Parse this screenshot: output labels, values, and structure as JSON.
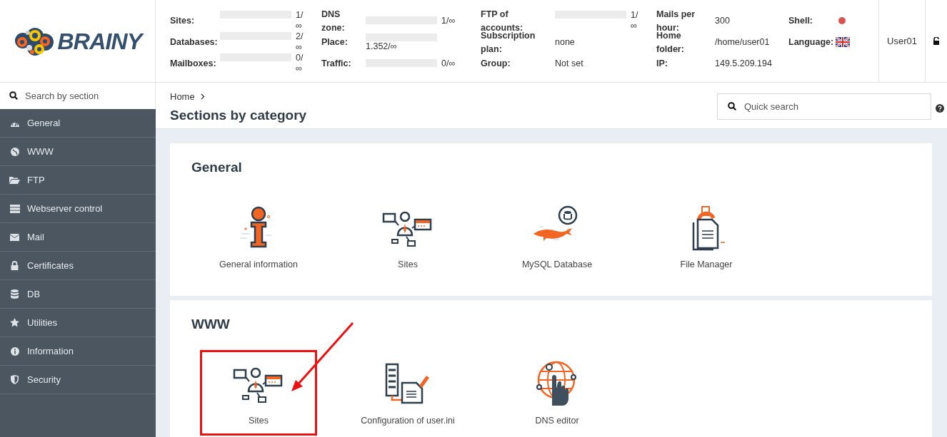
{
  "logo": {
    "text": "BRAINY"
  },
  "stats": [
    [
      {
        "label": "Sites:",
        "kind": "meter",
        "level": 0,
        "value": "1/∞"
      },
      {
        "label": "Databases:",
        "kind": "meter",
        "level": 0,
        "value": "2/∞"
      },
      {
        "label": "Mailboxes:",
        "kind": "meter",
        "level": 0,
        "value": "0/∞"
      }
    ],
    [
      {
        "label": "DNS zone:",
        "kind": "meter",
        "level": 0,
        "value": "1/∞"
      },
      {
        "label": "Place:",
        "kind": "meter",
        "level": 0,
        "value": "1.352/∞"
      },
      {
        "label": "Traffic:",
        "kind": "meter",
        "level": 0,
        "value": "0/∞"
      }
    ],
    [
      {
        "label": "FTP of accounts:",
        "kind": "meter",
        "level": 0,
        "value": "1/∞"
      },
      {
        "label": "Subscription plan:",
        "kind": "text",
        "value": "none"
      },
      {
        "label": "Group:",
        "kind": "text",
        "value": "Not set"
      }
    ],
    [
      {
        "label": "Mails per hour:",
        "kind": "text",
        "value": "300"
      },
      {
        "label": "Home folder:",
        "kind": "text",
        "value": "/home/user01"
      },
      {
        "label": "IP:",
        "kind": "text",
        "value": "149.5.209.194"
      }
    ],
    [
      {
        "label": "Shell:",
        "kind": "dot",
        "color": "#d9534f"
      },
      {
        "label": "Language:",
        "kind": "flag"
      }
    ]
  ],
  "user": {
    "name": "User01"
  },
  "sidebar": {
    "search": {
      "placeholder": "Search by section"
    },
    "items": [
      {
        "label": "General"
      },
      {
        "label": "WWW"
      },
      {
        "label": "FTP"
      },
      {
        "label": "Webserver control"
      },
      {
        "label": "Mail"
      },
      {
        "label": "Certificates"
      },
      {
        "label": "DB"
      },
      {
        "label": "Utilities"
      },
      {
        "label": "Information"
      },
      {
        "label": "Security"
      }
    ]
  },
  "breadcrumb": [
    "Home"
  ],
  "page_title": "Sections by category",
  "quick_search": {
    "placeholder": "Quick search"
  },
  "sections": [
    {
      "title": "General",
      "items": [
        {
          "label": "General information",
          "highlighted": false
        },
        {
          "label": "Sites",
          "highlighted": false
        },
        {
          "label": "MySQL Database",
          "highlighted": false
        },
        {
          "label": "File Manager",
          "highlighted": false
        }
      ]
    },
    {
      "title": "WWW",
      "items": [
        {
          "label": "Sites",
          "highlighted": true
        },
        {
          "label": "Configuration of user.ini",
          "highlighted": false
        },
        {
          "label": "DNS editor",
          "highlighted": false
        }
      ]
    }
  ]
}
